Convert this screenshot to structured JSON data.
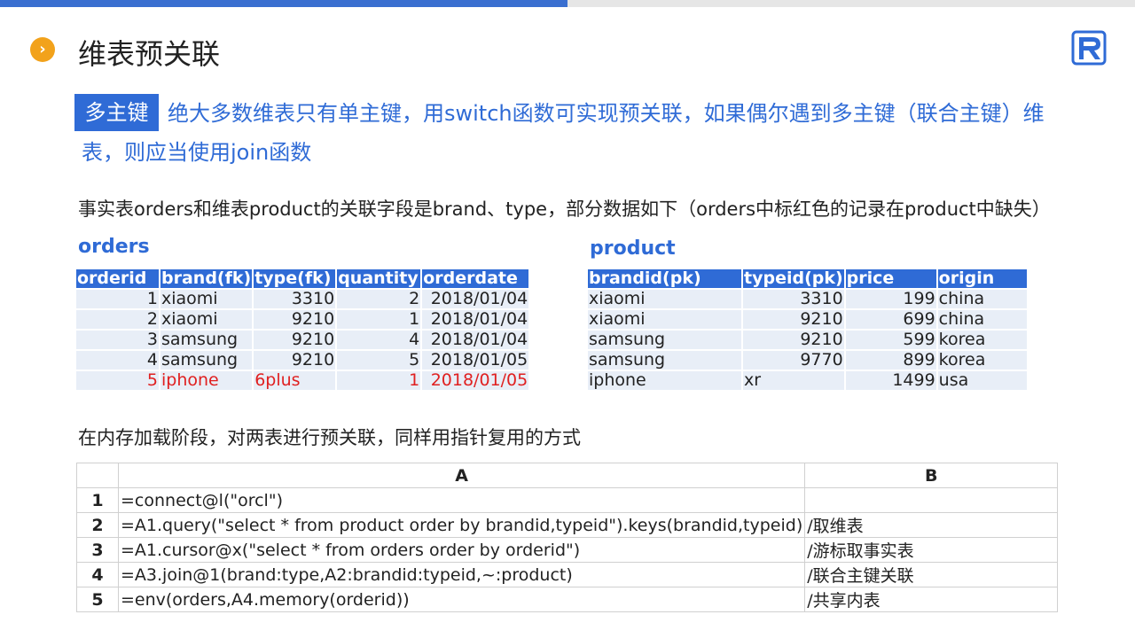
{
  "progress_fraction": 0.5,
  "title": "维表预关联",
  "tag": "多主键",
  "intro": "绝大多数维表只有单主键，用switch函数可实现预关联，如果偶尔遇到多主键（联合主键）维表，则应当使用join函数",
  "description": "事实表orders和维表product的关联字段是brand、type，部分数据如下（orders中标红色的记录在product中缺失）",
  "orders": {
    "name": "orders",
    "columns": [
      "orderid",
      "brand(fk)",
      "type(fk)",
      "quantity",
      "orderdate"
    ],
    "rows": [
      [
        "1",
        "xiaomi",
        "3310",
        "2",
        "2018/01/04"
      ],
      [
        "2",
        "xiaomi",
        "9210",
        "1",
        "2018/01/04"
      ],
      [
        "3",
        "samsung",
        "9210",
        "4",
        "2018/01/04"
      ],
      [
        "4",
        "samsung",
        "9210",
        "5",
        "2018/01/05"
      ],
      [
        "5",
        "iphone",
        "6plus",
        "1",
        "2018/01/05"
      ]
    ],
    "missing_rows": [
      4
    ],
    "highlight_color": "#e02020"
  },
  "product": {
    "name": "product",
    "columns": [
      "brandid(pk)",
      "typeid(pk)",
      "price",
      "origin"
    ],
    "rows": [
      [
        "xiaomi",
        "3310",
        "199",
        "china"
      ],
      [
        "xiaomi",
        "9210",
        "699",
        "china"
      ],
      [
        "samsung",
        "9210",
        "599",
        "korea"
      ],
      [
        "samsung",
        "9770",
        "899",
        "korea"
      ],
      [
        "iphone",
        "xr",
        "1499",
        "usa"
      ]
    ]
  },
  "description2": "在内存加载阶段，对两表进行预关联，同样用指针复用的方式",
  "code": {
    "col_a": "A",
    "col_b": "B",
    "rows": [
      {
        "n": "1",
        "a": "=connect@l(\"orcl\")",
        "b": ""
      },
      {
        "n": "2",
        "a": "=A1.query(\"select * from product order by brandid,typeid\").keys(brandid,typeid)",
        "b": "/取维表"
      },
      {
        "n": "3",
        "a": "=A1.cursor@x(\"select * from orders order by orderid\")",
        "b": "/游标取事实表"
      },
      {
        "n": "4",
        "a": "=A3.join@1(brand:type,A2:brandid:typeid,~:product)",
        "b": "/联合主键关联"
      },
      {
        "n": "5",
        "a": "=env(orders,A4.memory(orderid))",
        "b": "/共享内表"
      }
    ]
  },
  "colors": {
    "accent": "#2f6bd6",
    "bullet": "#f2a21b",
    "cell_bg": "#e8eef7"
  }
}
